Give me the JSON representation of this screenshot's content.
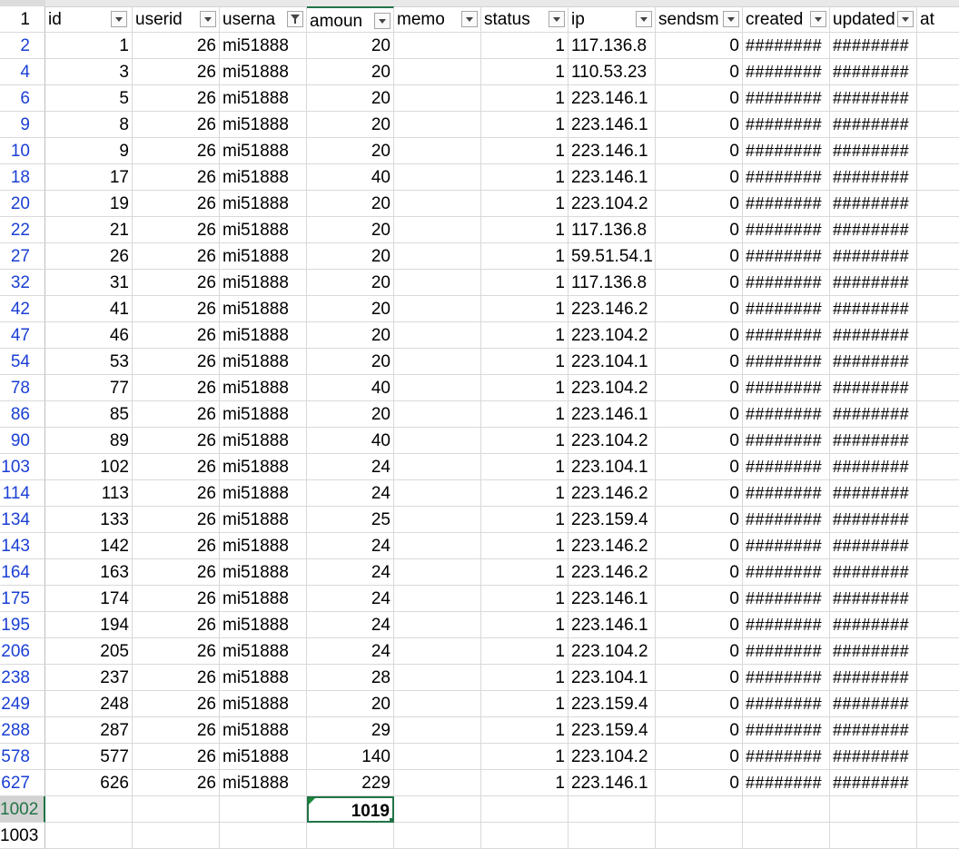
{
  "header": {
    "row_label": "1",
    "columns": [
      "id",
      "userid",
      "userna",
      "amoun",
      "memo",
      "status",
      "ip",
      "sendsm",
      "created",
      "updated",
      "at"
    ]
  },
  "rows": [
    {
      "rn": "2",
      "id": "1",
      "userid": "26",
      "username": "mi51888",
      "amount": "20",
      "status": "1",
      "ip": "117.136.8",
      "sendsms": "0",
      "created": "########",
      "updated": "########"
    },
    {
      "rn": "4",
      "id": "3",
      "userid": "26",
      "username": "mi51888",
      "amount": "20",
      "status": "1",
      "ip": "110.53.23",
      "sendsms": "0",
      "created": "########",
      "updated": "########"
    },
    {
      "rn": "6",
      "id": "5",
      "userid": "26",
      "username": "mi51888",
      "amount": "20",
      "status": "1",
      "ip": "223.146.1",
      "sendsms": "0",
      "created": "########",
      "updated": "########"
    },
    {
      "rn": "9",
      "id": "8",
      "userid": "26",
      "username": "mi51888",
      "amount": "20",
      "status": "1",
      "ip": "223.146.1",
      "sendsms": "0",
      "created": "########",
      "updated": "########"
    },
    {
      "rn": "10",
      "id": "9",
      "userid": "26",
      "username": "mi51888",
      "amount": "20",
      "status": "1",
      "ip": "223.146.1",
      "sendsms": "0",
      "created": "########",
      "updated": "########"
    },
    {
      "rn": "18",
      "id": "17",
      "userid": "26",
      "username": "mi51888",
      "amount": "40",
      "status": "1",
      "ip": "223.146.1",
      "sendsms": "0",
      "created": "########",
      "updated": "########"
    },
    {
      "rn": "20",
      "id": "19",
      "userid": "26",
      "username": "mi51888",
      "amount": "20",
      "status": "1",
      "ip": "223.104.2",
      "sendsms": "0",
      "created": "########",
      "updated": "########"
    },
    {
      "rn": "22",
      "id": "21",
      "userid": "26",
      "username": "mi51888",
      "amount": "20",
      "status": "1",
      "ip": "117.136.8",
      "sendsms": "0",
      "created": "########",
      "updated": "########"
    },
    {
      "rn": "27",
      "id": "26",
      "userid": "26",
      "username": "mi51888",
      "amount": "20",
      "status": "1",
      "ip": "59.51.54.1",
      "sendsms": "0",
      "created": "########",
      "updated": "########"
    },
    {
      "rn": "32",
      "id": "31",
      "userid": "26",
      "username": "mi51888",
      "amount": "20",
      "status": "1",
      "ip": "117.136.8",
      "sendsms": "0",
      "created": "########",
      "updated": "########"
    },
    {
      "rn": "42",
      "id": "41",
      "userid": "26",
      "username": "mi51888",
      "amount": "20",
      "status": "1",
      "ip": "223.146.2",
      "sendsms": "0",
      "created": "########",
      "updated": "########"
    },
    {
      "rn": "47",
      "id": "46",
      "userid": "26",
      "username": "mi51888",
      "amount": "20",
      "status": "1",
      "ip": "223.104.2",
      "sendsms": "0",
      "created": "########",
      "updated": "########"
    },
    {
      "rn": "54",
      "id": "53",
      "userid": "26",
      "username": "mi51888",
      "amount": "20",
      "status": "1",
      "ip": "223.104.1",
      "sendsms": "0",
      "created": "########",
      "updated": "########"
    },
    {
      "rn": "78",
      "id": "77",
      "userid": "26",
      "username": "mi51888",
      "amount": "40",
      "status": "1",
      "ip": "223.104.2",
      "sendsms": "0",
      "created": "########",
      "updated": "########"
    },
    {
      "rn": "86",
      "id": "85",
      "userid": "26",
      "username": "mi51888",
      "amount": "20",
      "status": "1",
      "ip": "223.146.1",
      "sendsms": "0",
      "created": "########",
      "updated": "########"
    },
    {
      "rn": "90",
      "id": "89",
      "userid": "26",
      "username": "mi51888",
      "amount": "40",
      "status": "1",
      "ip": "223.104.2",
      "sendsms": "0",
      "created": "########",
      "updated": "########"
    },
    {
      "rn": "103",
      "id": "102",
      "userid": "26",
      "username": "mi51888",
      "amount": "24",
      "status": "1",
      "ip": "223.104.1",
      "sendsms": "0",
      "created": "########",
      "updated": "########"
    },
    {
      "rn": "114",
      "id": "113",
      "userid": "26",
      "username": "mi51888",
      "amount": "24",
      "status": "1",
      "ip": "223.146.2",
      "sendsms": "0",
      "created": "########",
      "updated": "########"
    },
    {
      "rn": "134",
      "id": "133",
      "userid": "26",
      "username": "mi51888",
      "amount": "25",
      "status": "1",
      "ip": "223.159.4",
      "sendsms": "0",
      "created": "########",
      "updated": "########"
    },
    {
      "rn": "143",
      "id": "142",
      "userid": "26",
      "username": "mi51888",
      "amount": "24",
      "status": "1",
      "ip": "223.146.2",
      "sendsms": "0",
      "created": "########",
      "updated": "########"
    },
    {
      "rn": "164",
      "id": "163",
      "userid": "26",
      "username": "mi51888",
      "amount": "24",
      "status": "1",
      "ip": "223.146.2",
      "sendsms": "0",
      "created": "########",
      "updated": "########"
    },
    {
      "rn": "175",
      "id": "174",
      "userid": "26",
      "username": "mi51888",
      "amount": "24",
      "status": "1",
      "ip": "223.146.1",
      "sendsms": "0",
      "created": "########",
      "updated": "########"
    },
    {
      "rn": "195",
      "id": "194",
      "userid": "26",
      "username": "mi51888",
      "amount": "24",
      "status": "1",
      "ip": "223.146.1",
      "sendsms": "0",
      "created": "########",
      "updated": "########"
    },
    {
      "rn": "206",
      "id": "205",
      "userid": "26",
      "username": "mi51888",
      "amount": "24",
      "status": "1",
      "ip": "223.104.2",
      "sendsms": "0",
      "created": "########",
      "updated": "########"
    },
    {
      "rn": "238",
      "id": "237",
      "userid": "26",
      "username": "mi51888",
      "amount": "28",
      "status": "1",
      "ip": "223.104.1",
      "sendsms": "0",
      "created": "########",
      "updated": "########"
    },
    {
      "rn": "249",
      "id": "248",
      "userid": "26",
      "username": "mi51888",
      "amount": "20",
      "status": "1",
      "ip": "223.159.4",
      "sendsms": "0",
      "created": "########",
      "updated": "########"
    },
    {
      "rn": "288",
      "id": "287",
      "userid": "26",
      "username": "mi51888",
      "amount": "29",
      "status": "1",
      "ip": "223.159.4",
      "sendsms": "0",
      "created": "########",
      "updated": "########"
    },
    {
      "rn": "578",
      "id": "577",
      "userid": "26",
      "username": "mi51888",
      "amount": "140",
      "status": "1",
      "ip": "223.104.2",
      "sendsms": "0",
      "created": "########",
      "updated": "########"
    },
    {
      "rn": "627",
      "id": "626",
      "userid": "26",
      "username": "mi51888",
      "amount": "229",
      "status": "1",
      "ip": "223.146.1",
      "sendsms": "0",
      "created": "########",
      "updated": "########"
    }
  ],
  "total_row": {
    "rn": "1002",
    "amount": "1019",
    "warning_icon": "warning-icon"
  },
  "empty_row": {
    "rn": "1003"
  },
  "colors": {
    "selection_green": "#217346",
    "row_number_blue": "#1a3fd4",
    "gridline": "#d9d9d9"
  }
}
